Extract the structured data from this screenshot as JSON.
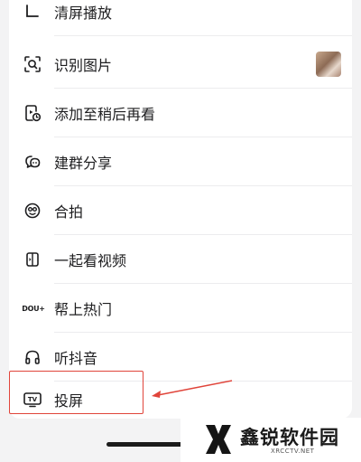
{
  "menu": {
    "items": [
      {
        "label": "清屏播放",
        "icon": "clear-screen-icon"
      },
      {
        "label": "识别图片",
        "icon": "scan-image-icon"
      },
      {
        "label": "添加至稍后再看",
        "icon": "watch-later-icon"
      },
      {
        "label": "建群分享",
        "icon": "group-share-icon"
      },
      {
        "label": "合拍",
        "icon": "duet-icon"
      },
      {
        "label": "一起看视频",
        "icon": "watch-together-icon"
      },
      {
        "label": "帮上热门",
        "icon": "doujia-icon",
        "icon_text": "DOU+"
      },
      {
        "label": "听抖音",
        "icon": "headphones-icon"
      },
      {
        "label": "投屏",
        "icon": "cast-screen-icon",
        "icon_text": "TV"
      }
    ]
  },
  "watermark": {
    "name": "鑫锐软件园",
    "url": "XRCCTV.NET"
  },
  "colors": {
    "highlight": "#e0443a",
    "arrow": "#e0443a"
  }
}
